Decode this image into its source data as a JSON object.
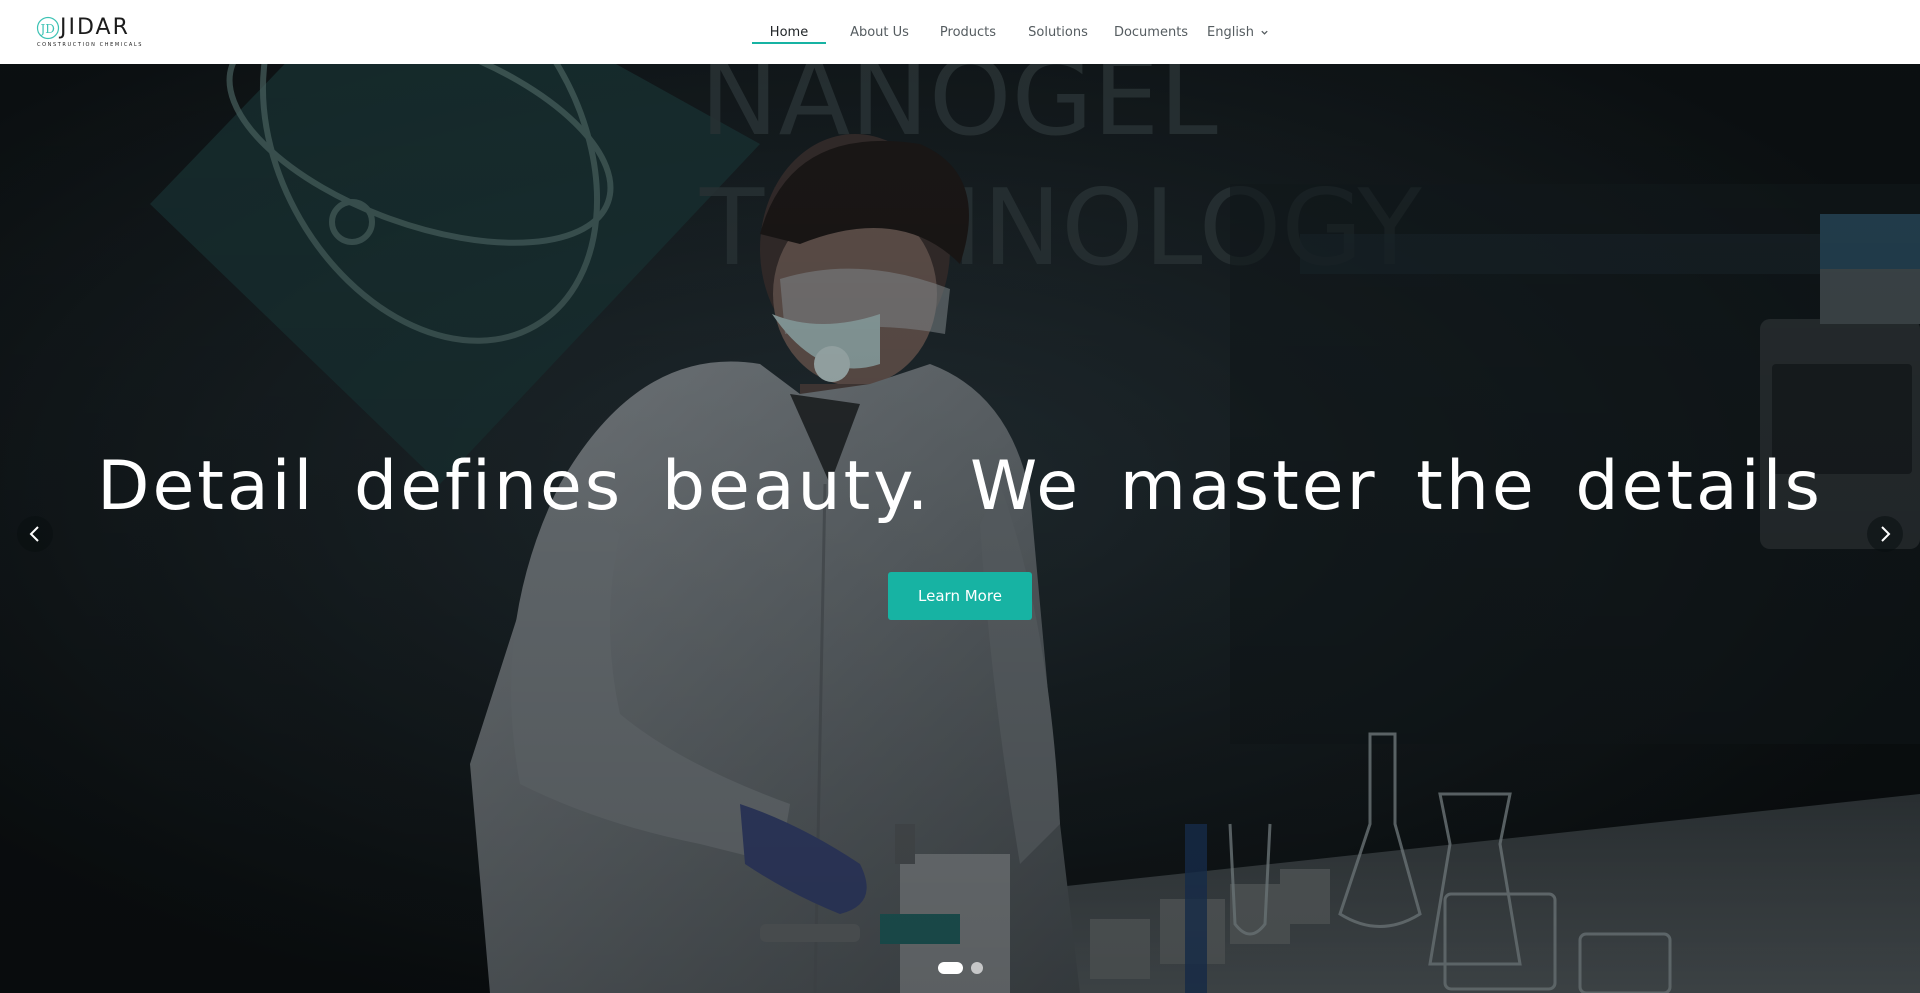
{
  "brand": {
    "name": "JIDAR",
    "tagline": "CONSTRUCTION CHEMICALS",
    "accent_color": "#17b3a3"
  },
  "nav": {
    "items": [
      {
        "label": "Home",
        "active": true
      },
      {
        "label": "About Us",
        "active": false
      },
      {
        "label": "Products",
        "active": false
      },
      {
        "label": "Solutions",
        "active": false
      },
      {
        "label": "Documents",
        "active": false
      }
    ],
    "language": "English"
  },
  "hero": {
    "headline": "Detail defines beauty. We master the details",
    "cta_label": "Learn More",
    "background_text": [
      "NANOGEL",
      "TECHNOLOGY"
    ],
    "slide_count": 2,
    "active_slide": 1
  },
  "icons": {
    "prev": "chevron-left-icon",
    "next": "chevron-right-icon",
    "language_dropdown": "chevron-down-icon"
  }
}
